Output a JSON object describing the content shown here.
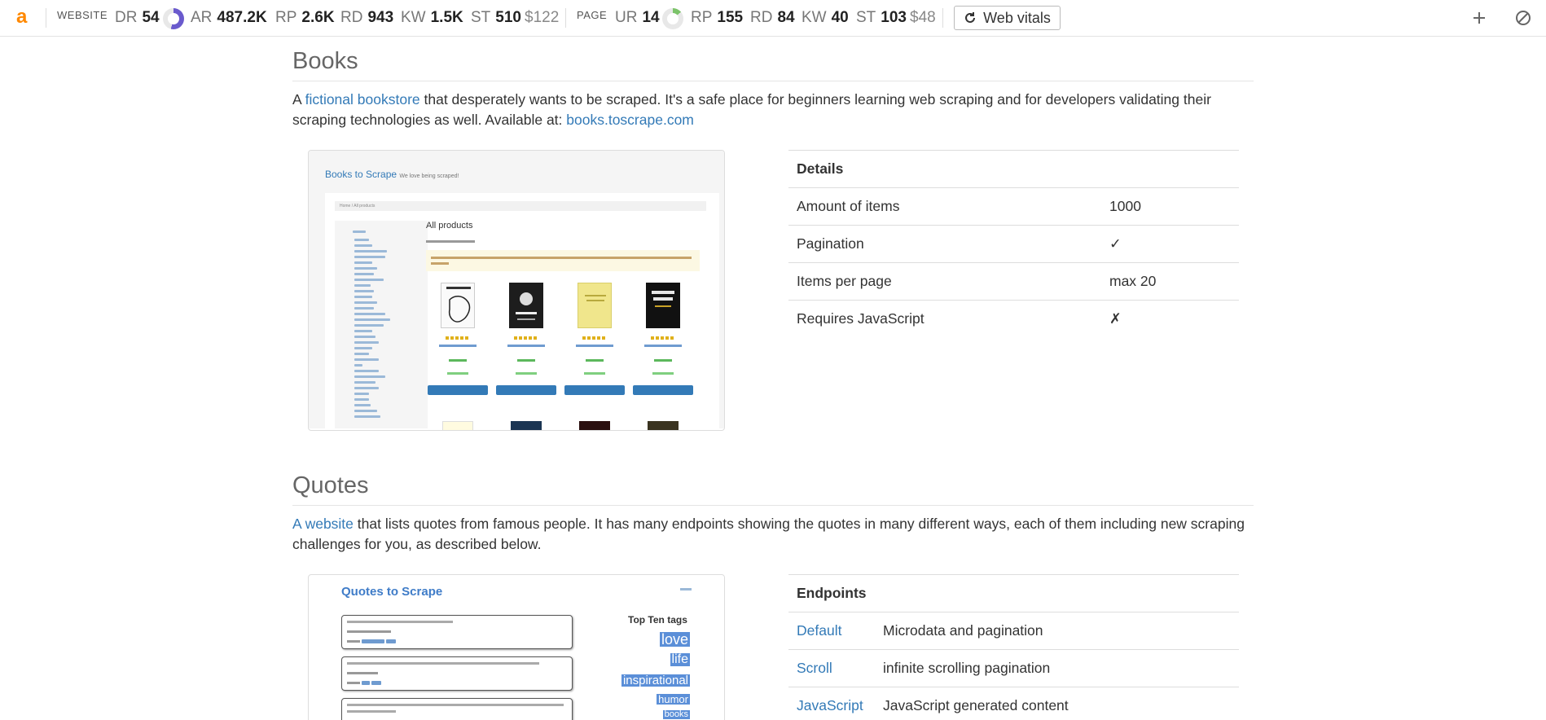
{
  "toolbar": {
    "website_label": "WEBSITE",
    "page_label": "PAGE",
    "website": [
      {
        "k": "DR",
        "v": "54"
      },
      {
        "k": "AR",
        "v": "487.2K"
      },
      {
        "k": "RP",
        "v": "2.6K"
      },
      {
        "k": "RD",
        "v": "943"
      },
      {
        "k": "KW",
        "v": "1.5K"
      },
      {
        "k": "ST",
        "v": "510"
      }
    ],
    "website_price": "$122",
    "page": [
      {
        "k": "UR",
        "v": "14"
      },
      {
        "k": "RP",
        "v": "155"
      },
      {
        "k": "RD",
        "v": "84"
      },
      {
        "k": "KW",
        "v": "40"
      },
      {
        "k": "ST",
        "v": "103"
      }
    ],
    "page_price": "$48",
    "dr_ring_fraction": 0.54,
    "ur_ring_fraction": 0.14,
    "web_vitals_label": "Web vitals",
    "colors": {
      "logo": "#ff8800",
      "dr_ring": "#6a5acd",
      "ur_ring": "#7cc36a"
    }
  },
  "books": {
    "title": "Books",
    "desc_pre": "A ",
    "desc_link": "fictional bookstore",
    "desc_mid": " that desperately wants to be scraped. It's a safe place for beginners learning web scraping and for developers validating their scraping technologies as well. Available at: ",
    "desc_link2": "books.toscrape.com",
    "preview": {
      "brand": "Books to Scrape",
      "tagline": "We love being scraped!",
      "crumb": "Home / All products",
      "heading": "All products"
    },
    "details": {
      "header": "Details",
      "rows": [
        {
          "label": "Amount of items",
          "value": "1000"
        },
        {
          "label": "Pagination",
          "value": "✓"
        },
        {
          "label": "Items per page",
          "value": "max 20"
        },
        {
          "label": "Requires JavaScript",
          "value": "✗"
        }
      ]
    }
  },
  "quotes": {
    "title": "Quotes",
    "desc_link": "A website",
    "desc_rest": " that lists quotes from famous people. It has many endpoints showing the quotes in many different ways, each of them including new scraping challenges for you, as described below.",
    "preview": {
      "brand": "Quotes to Scrape",
      "top_tags": "Top Ten tags",
      "tags": [
        "love",
        "life",
        "inspirational",
        "humor",
        "books"
      ]
    },
    "endpoints": {
      "header": "Endpoints",
      "rows": [
        {
          "name": "Default",
          "desc": "Microdata and pagination"
        },
        {
          "name": "Scroll",
          "desc": "infinite scrolling pagination"
        },
        {
          "name": "JavaScript",
          "desc": "JavaScript generated content"
        }
      ]
    }
  }
}
